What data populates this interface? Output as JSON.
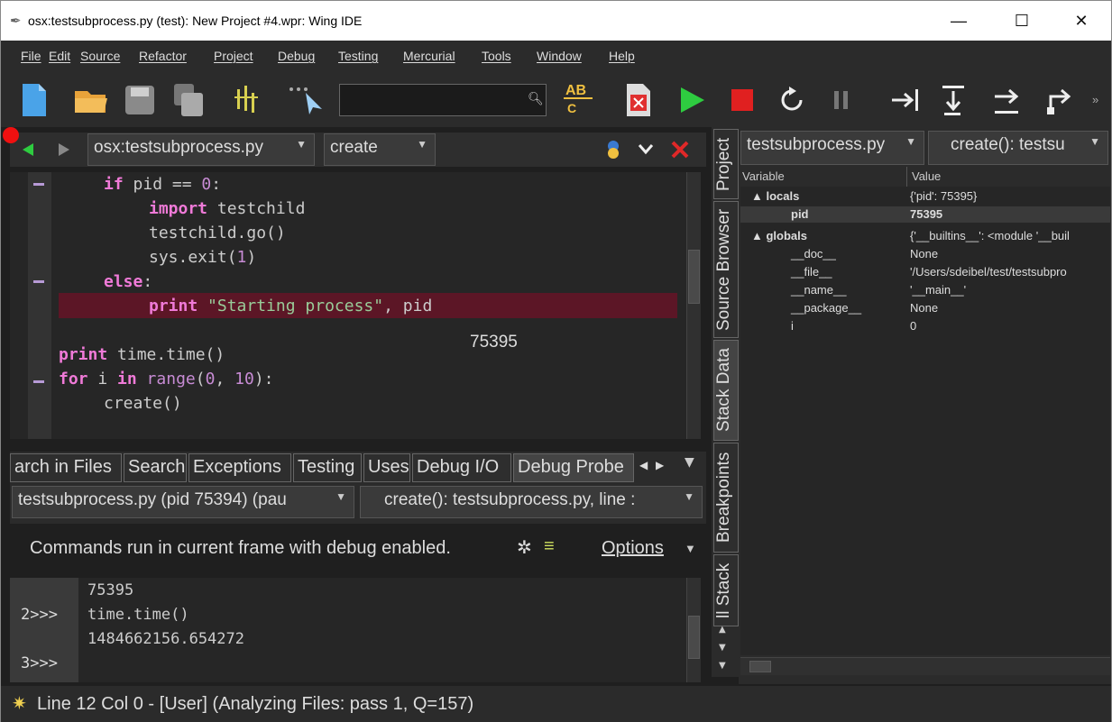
{
  "window": {
    "title": "osx:testsubprocess.py (test): New Project #4.wpr: Wing IDE",
    "minimize": "—",
    "maximize": "☐",
    "close": "✕"
  },
  "menu": [
    "File",
    "Edit",
    "Source",
    "Refactor",
    "Project",
    "Debug",
    "Testing",
    "Mercurial",
    "Tools",
    "Window",
    "Help"
  ],
  "toolbar": {
    "search_value": "",
    "overflow": "»"
  },
  "editor": {
    "file_combo": "osx:testsubprocess.py",
    "scope_combo": "create",
    "lines": {
      "l1_kw": "if",
      "l1_rest": " pid == ",
      "l1_num": "0",
      "l1_end": ":",
      "l2_kw": "import",
      "l2_rest": " testchild",
      "l3": "testchild.go()",
      "l4_a": "sys.exit(",
      "l4_num": "1",
      "l4_b": ")",
      "l5_kw": "else",
      "l5_end": ":",
      "l6_kw": "print",
      "l6_str": " \"Starting process\"",
      "l6_rest": ", pid",
      "l8_kw": "print",
      "l8_rest": " time.time()",
      "l9_kw1": "for",
      "l9_a": " i ",
      "l9_kw2": "in",
      "l9_fn": " range",
      "l9_b": "(",
      "l9_n1": "0",
      "l9_c": ", ",
      "l9_n2": "10",
      "l9_d": "):",
      "l10": "create()"
    },
    "inline_value": "75395"
  },
  "bottom_tabs": [
    "arch in Files",
    "Search",
    "Exceptions",
    "Testing",
    "Uses",
    "Debug I/O",
    "Debug Probe"
  ],
  "probe": {
    "process_combo": "testsubprocess.py (pid 75394) (pau",
    "frame_combo": "create(): testsubprocess.py, line :",
    "info": "Commands run in current frame with debug enabled.",
    "options": "Options",
    "console": [
      {
        "prompt": "",
        "text": "75395"
      },
      {
        "prompt": "2>>>",
        "text": "time.time()"
      },
      {
        "prompt": "",
        "text": "1484662156.654272"
      },
      {
        "prompt": "3>>>",
        "text": ""
      }
    ]
  },
  "status": "Line 12 Col 0 - [User] (Analyzing Files: pass 1, Q=157)",
  "side_tabs": [
    "Project",
    "Source Browser",
    "Stack Data",
    "Breakpoints",
    "ll Stack"
  ],
  "stack": {
    "file_combo": "testsubprocess.py",
    "frame_combo": "create(): testsu",
    "col_variable": "Variable",
    "col_value": "Value",
    "rows": [
      {
        "name": "▲ locals",
        "value": "{'pid': 75395}"
      },
      {
        "name": "pid",
        "value": "75395"
      },
      {
        "name": "▲ globals",
        "value": "{'__builtins__': <module '__buil"
      },
      {
        "name": "__doc__",
        "value": "None"
      },
      {
        "name": "__file__",
        "value": "'/Users/sdeibel/test/testsubpro"
      },
      {
        "name": "__name__",
        "value": "'__main__'"
      },
      {
        "name": "__package__",
        "value": "None"
      },
      {
        "name": "i",
        "value": "0"
      }
    ]
  },
  "colors": {
    "breakpoint": "#f01010",
    "current_line": "#5c1626",
    "run": "#2ecc40",
    "stop": "#e02020"
  }
}
